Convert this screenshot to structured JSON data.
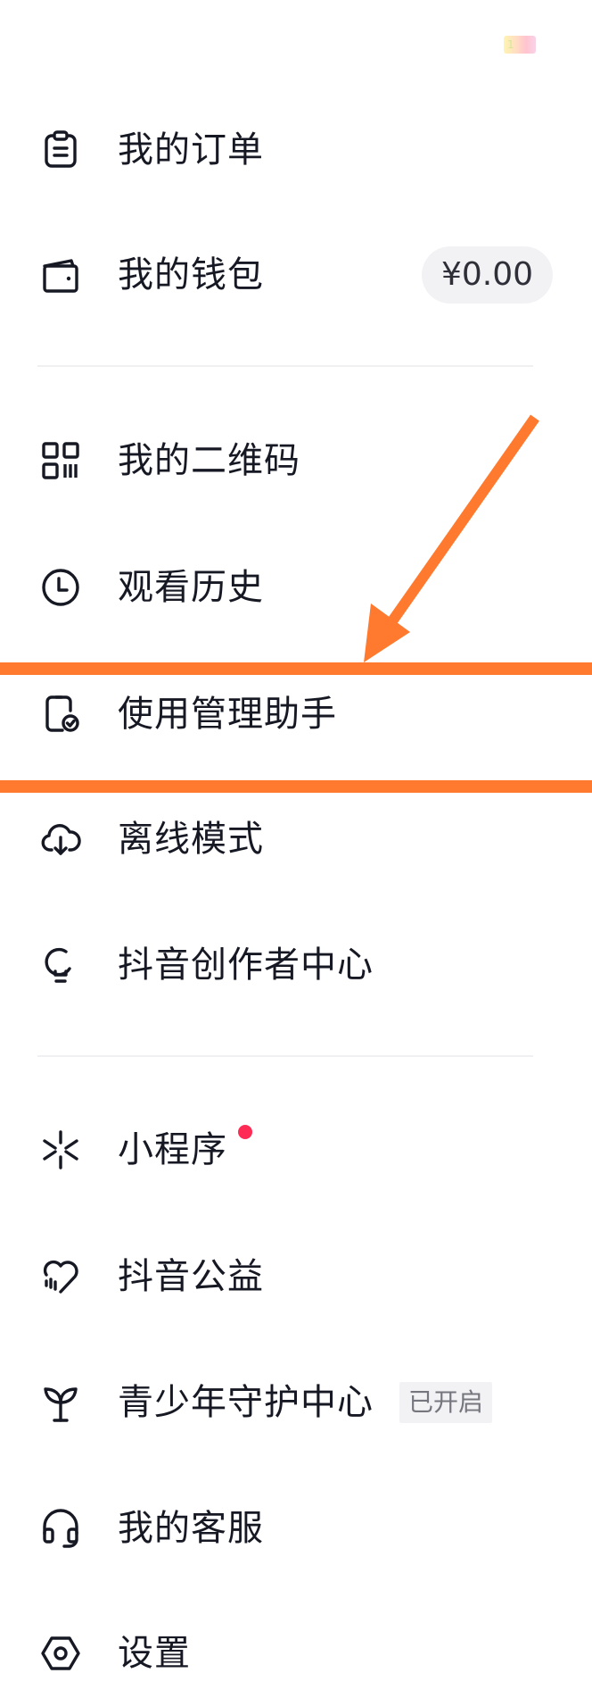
{
  "top_badge": {
    "text": "1"
  },
  "menu": {
    "orders": {
      "label": "我的订单",
      "icon": "clipboard-icon"
    },
    "wallet": {
      "label": "我的钱包",
      "icon": "wallet-icon",
      "balance": "¥0.00"
    },
    "qrcode": {
      "label": "我的二维码",
      "icon": "qr-code-icon"
    },
    "history": {
      "label": "观看历史",
      "icon": "clock-icon"
    },
    "usage_manager": {
      "label": "使用管理助手",
      "icon": "phone-check-icon"
    },
    "offline": {
      "label": "离线模式",
      "icon": "cloud-download-icon"
    },
    "creator_center": {
      "label": "抖音创作者中心",
      "icon": "lightbulb-icon"
    },
    "mini_programs": {
      "label": "小程序",
      "icon": "asterisk-icon",
      "has_notification": true
    },
    "charity": {
      "label": "抖音公益",
      "icon": "heart-icon"
    },
    "teen_mode": {
      "label": "青少年守护中心",
      "icon": "sprout-icon",
      "status": "已开启"
    },
    "customer_service": {
      "label": "我的客服",
      "icon": "headset-icon"
    },
    "settings": {
      "label": "设置",
      "icon": "hexagon-settings-icon"
    }
  },
  "colors": {
    "text": "#161823",
    "icon": "#161823",
    "highlight": "#ff7a2e",
    "notification_dot": "#fe2c55",
    "pill_bg": "#f2f2f4"
  }
}
